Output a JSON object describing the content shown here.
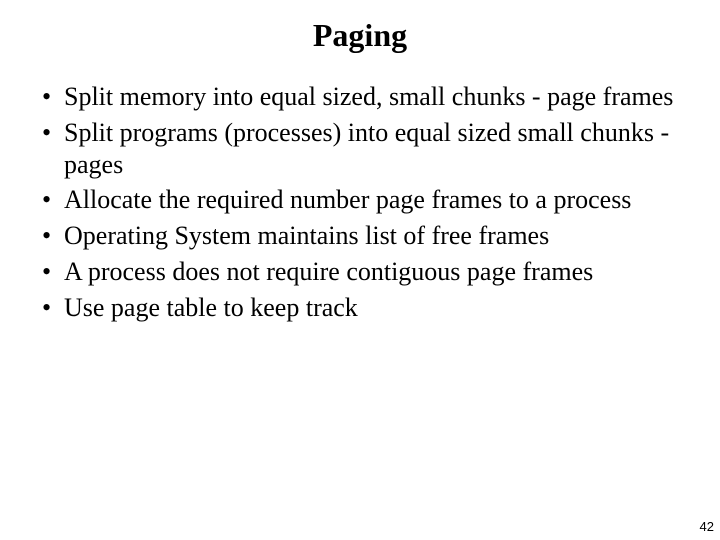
{
  "slide": {
    "title": "Paging",
    "bullets": [
      "Split memory into equal sized, small chunks - page frames",
      "Split programs (processes) into equal sized small chunks - pages",
      "Allocate the required number page frames to a process",
      "Operating System maintains list of free frames",
      "A process does not require contiguous page frames",
      "Use page table to keep track"
    ],
    "page_number": "42"
  }
}
